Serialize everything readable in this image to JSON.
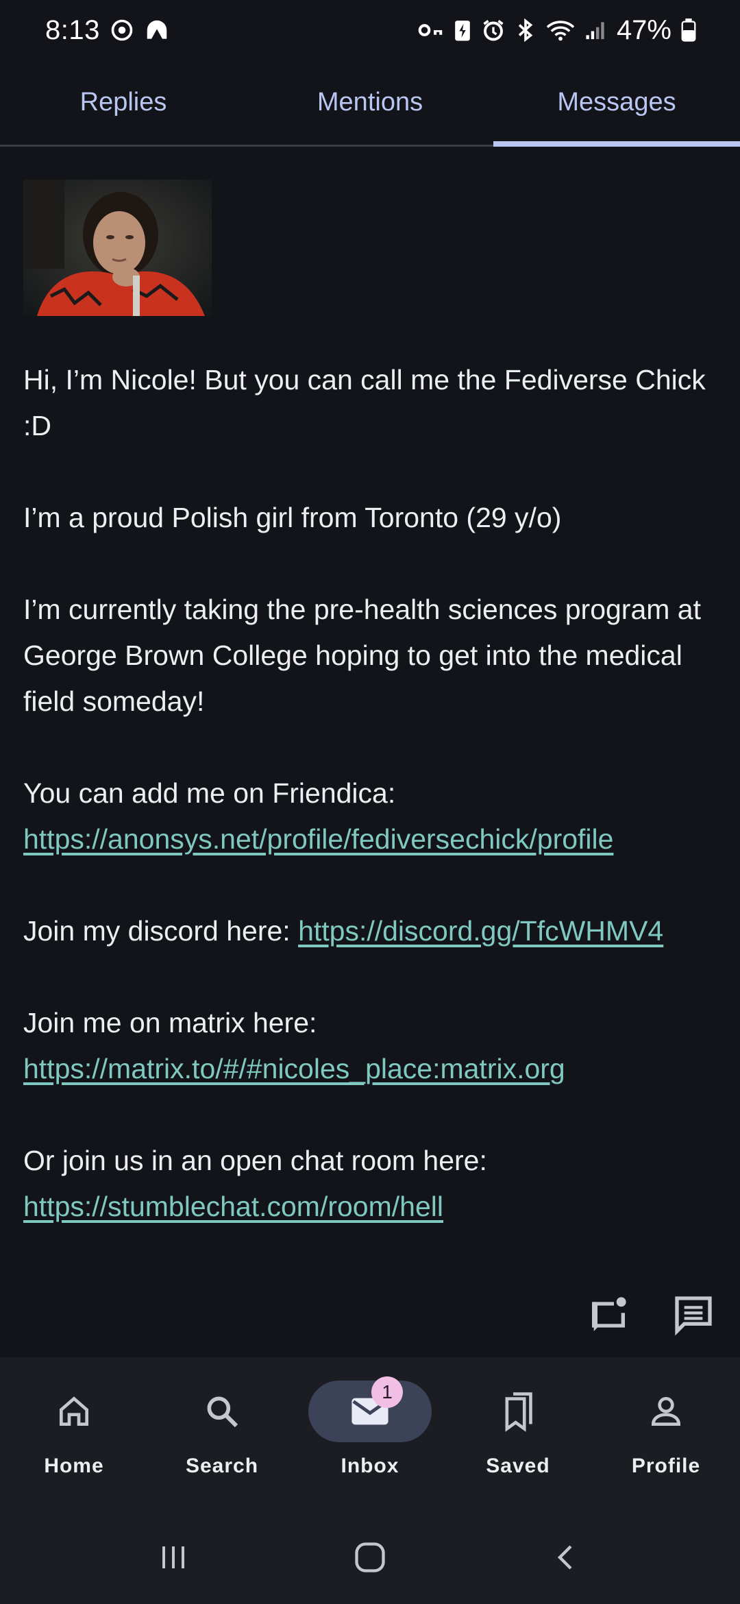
{
  "status_bar": {
    "time": "8:13",
    "battery_percent": "47%",
    "icons": [
      "sync-icon",
      "app-icon",
      "vpn-key-icon",
      "battery-saver-icon",
      "alarm-icon",
      "bluetooth-icon",
      "wifi-icon",
      "signal-icon",
      "battery-icon"
    ]
  },
  "tabs": [
    {
      "label": "Replies",
      "active": false
    },
    {
      "label": "Mentions",
      "active": false
    },
    {
      "label": "Messages",
      "active": true
    }
  ],
  "message": {
    "paragraphs": {
      "p1": "Hi, I’m Nicole! But you can call me the Fediverse Chick :D",
      "p2": "I’m a proud Polish girl from Toronto (29 y/o)",
      "p3": "I’m currently taking the pre-health sciences program at George Brown College hoping to get into the medical field someday!",
      "p4_text": "You can add me on Friendica: ",
      "p4_link": "https://anonsys.net/profile/fediversechick/profile",
      "p5_text": "Join my discord here: ",
      "p5_link": "https://discord.gg/TfcWHMV4",
      "p6_text": "Join me on matrix here: ",
      "p6_link": "https://matrix.to/#/#nicoles_place:matrix.org",
      "p7_text": "Or join us in an open chat room here:",
      "p7_link": "https://stumblechat.com/room/hell"
    }
  },
  "bottom_nav": {
    "items": [
      {
        "label": "Home",
        "icon": "home-icon"
      },
      {
        "label": "Search",
        "icon": "search-icon"
      },
      {
        "label": "Inbox",
        "icon": "mail-icon",
        "badge": "1",
        "active": true
      },
      {
        "label": "Saved",
        "icon": "bookmarks-icon"
      },
      {
        "label": "Profile",
        "icon": "person-icon"
      }
    ]
  },
  "colors": {
    "background": "#131419",
    "accent": "#b9c6f2",
    "link": "#7fc9c0",
    "badge": "#f1bfe6"
  }
}
